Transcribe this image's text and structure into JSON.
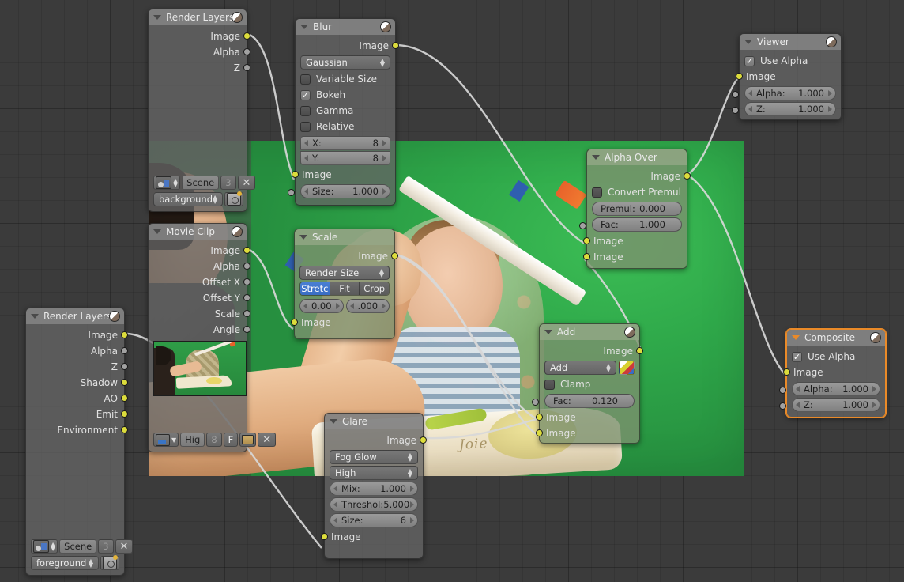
{
  "editor": {
    "name": "Blender Compositor Node Editor",
    "background_color": "#3b3b3b",
    "grid_color": "#333333",
    "selected_color": "#ea8a28"
  },
  "backdrop": {
    "description": "Green-screen video backdrop: baby in high chair with adult arm and paper wand",
    "logo_text": "Joie"
  },
  "nodes": {
    "render_layers_bg": {
      "title": "Render Layers",
      "outputs": [
        "Image",
        "Alpha",
        "Z"
      ],
      "scene_name": "Scene",
      "scene_users": "3",
      "layer_name": "background",
      "close_label": "✕"
    },
    "blur": {
      "title": "Blur",
      "outputs": [
        "Image"
      ],
      "filter_type": "Gaussian",
      "checks": [
        {
          "label": "Variable Size",
          "checked": false
        },
        {
          "label": "Bokeh",
          "checked": true
        },
        {
          "label": "Gamma",
          "checked": false
        },
        {
          "label": "Relative",
          "checked": false
        }
      ],
      "x_label": "X:",
      "x_value": "8",
      "y_label": "Y:",
      "y_value": "8",
      "inputs": [
        "Image"
      ],
      "size_label": "Size:",
      "size_value": "1.000"
    },
    "viewer": {
      "title": "Viewer",
      "use_alpha_label": "Use Alpha",
      "use_alpha": true,
      "inputs": [
        "Image"
      ],
      "alpha_label": "Alpha:",
      "alpha_value": "1.000",
      "z_label": "Z:",
      "z_value": "1.000"
    },
    "movie_clip": {
      "title": "Movie Clip",
      "outputs": [
        "Image",
        "Alpha",
        "Offset X",
        "Offset Y",
        "Scale",
        "Angle"
      ],
      "footer": {
        "clip_name": "Hig",
        "users": "8",
        "fake_user": "F",
        "close_label": "✕"
      }
    },
    "scale": {
      "title": "Scale",
      "outputs": [
        "Image"
      ],
      "space": "Render Size",
      "fit_modes": [
        "Stretc",
        "Fit",
        "Crop"
      ],
      "fit_active": "Stretc",
      "offset_x": "0.00",
      "offset_y": ".000",
      "inputs": [
        "Image"
      ]
    },
    "alpha_over": {
      "title": "Alpha Over",
      "outputs": [
        "Image"
      ],
      "convert_premul_label": "Convert Premul",
      "convert_premul": false,
      "premul_label": "Premul:",
      "premul_value": "0.000",
      "fac_label": "Fac:",
      "fac_value": "1.000",
      "inputs": [
        "Image",
        "Image"
      ]
    },
    "render_layers_fg": {
      "title": "Render Layers",
      "outputs": [
        "Image",
        "Alpha",
        "Z",
        "Shadow",
        "AO",
        "Emit",
        "Environment"
      ],
      "scene_name": "Scene",
      "scene_users": "3",
      "layer_name": "foreground",
      "close_label": "✕"
    },
    "glare": {
      "title": "Glare",
      "outputs": [
        "Image"
      ],
      "glare_type": "Fog Glow",
      "quality": "High",
      "mix_label": "Mix:",
      "mix_value": "1.000",
      "threshold_label": "Threshol:",
      "threshold_value": "5.000",
      "size_label": "Size:",
      "size_value": "6",
      "inputs": [
        "Image"
      ]
    },
    "add": {
      "title": "Add",
      "outputs": [
        "Image"
      ],
      "blend_mode": "Add",
      "clamp_label": "Clamp",
      "clamp": false,
      "fac_label": "Fac:",
      "fac_value": "0.120",
      "inputs": [
        "Image",
        "Image"
      ]
    },
    "composite": {
      "title": "Composite",
      "selected": true,
      "use_alpha_label": "Use Alpha",
      "use_alpha": true,
      "inputs": [
        "Image"
      ],
      "alpha_label": "Alpha:",
      "alpha_value": "1.000",
      "z_label": "Z:",
      "z_value": "1.000"
    }
  }
}
